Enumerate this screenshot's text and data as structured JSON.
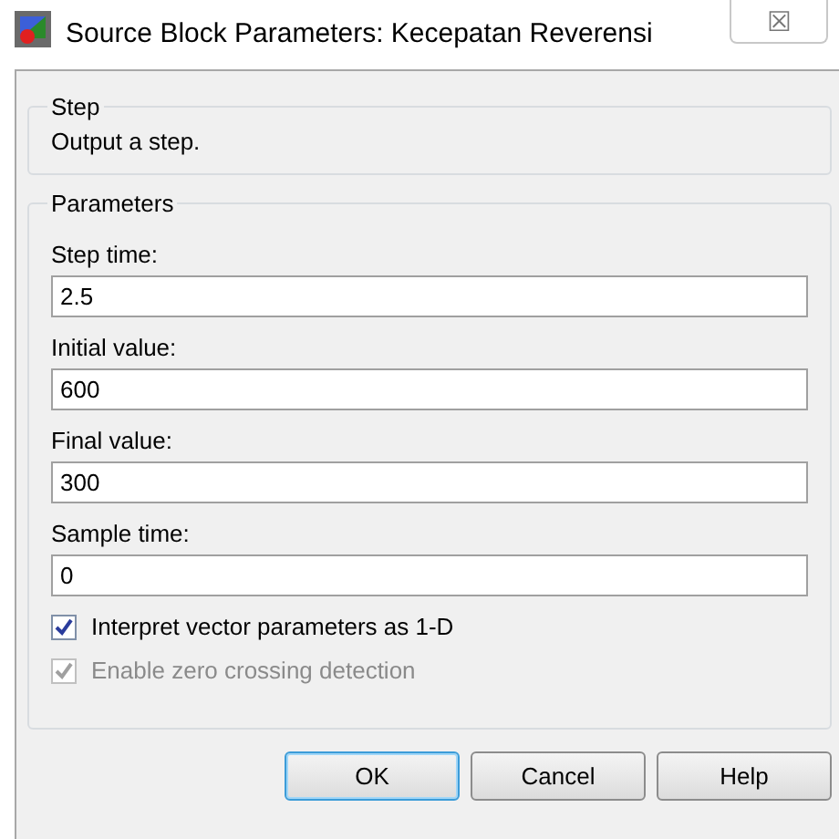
{
  "window": {
    "title": "Source Block Parameters: Kecepatan Reverensi",
    "close": "☒"
  },
  "description_group": {
    "title": "Step",
    "text": "Output a step."
  },
  "parameters_group": {
    "title": "Parameters",
    "fields": [
      {
        "label": "Step time:",
        "value": "2.5"
      },
      {
        "label": "Initial value:",
        "value": "600"
      },
      {
        "label": "Final value:",
        "value": "300"
      },
      {
        "label": "Sample time:",
        "value": "0"
      }
    ],
    "checkboxes": [
      {
        "label": "Interpret vector parameters as 1-D",
        "checked": true,
        "disabled": false
      },
      {
        "label": "Enable zero crossing detection",
        "checked": true,
        "disabled": true
      }
    ]
  },
  "buttons": [
    {
      "label": "OK",
      "default": true
    },
    {
      "label": "Cancel",
      "default": false
    },
    {
      "label": "Help",
      "default": false
    }
  ]
}
